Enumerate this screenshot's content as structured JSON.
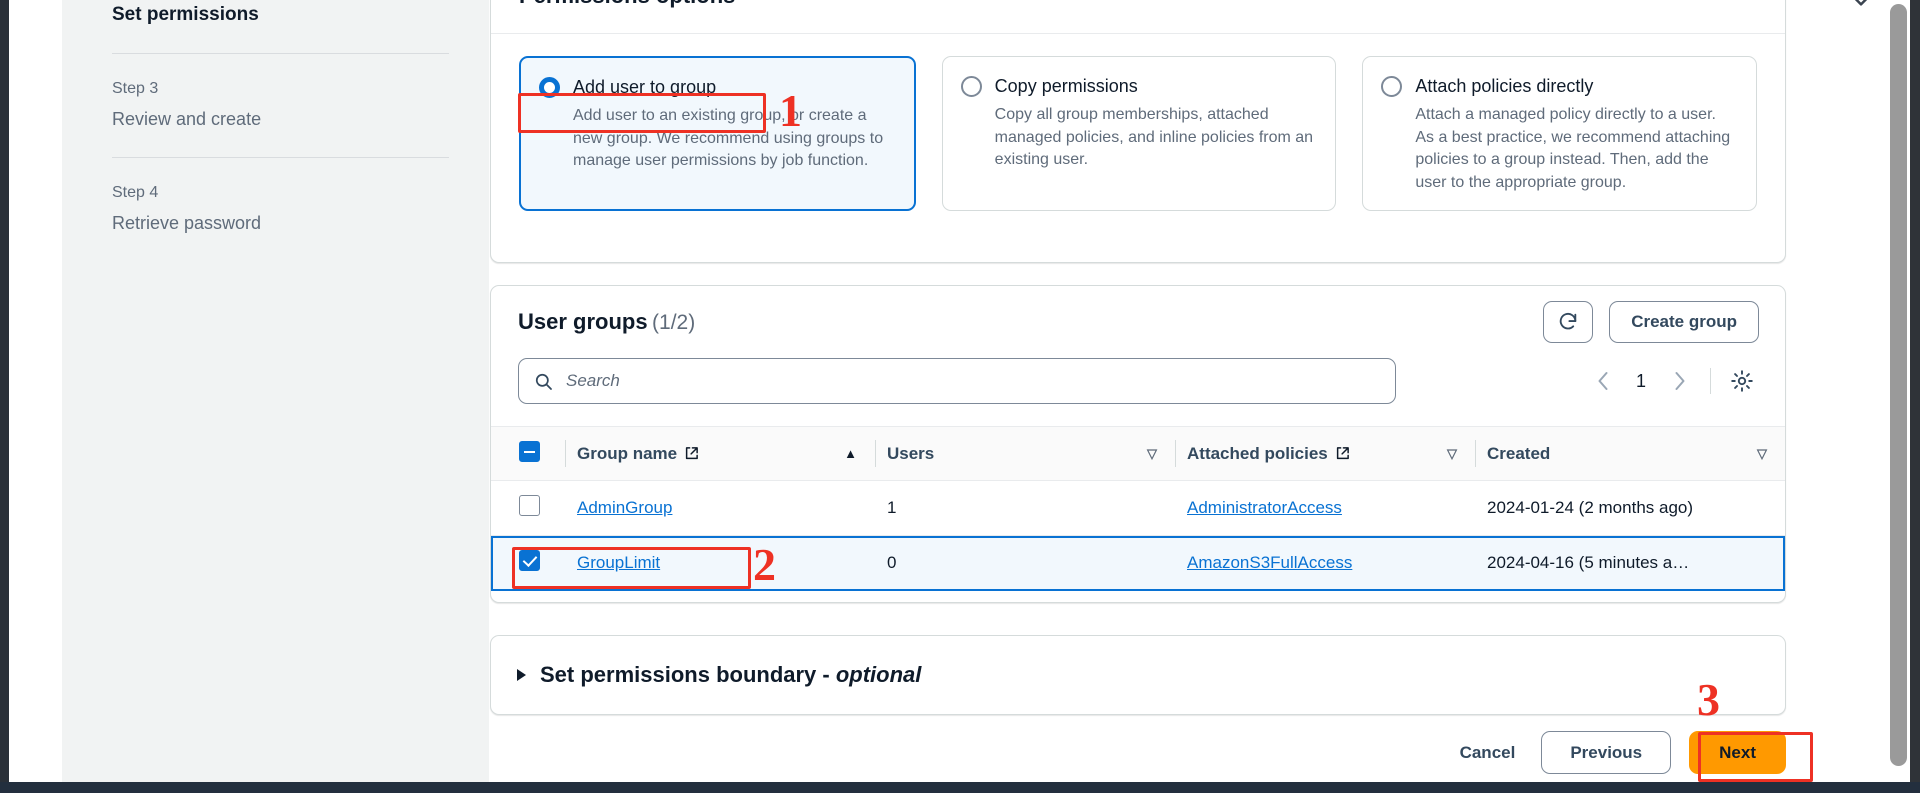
{
  "sidebar": {
    "current_step_title": "Set permissions",
    "steps": [
      {
        "num": "Step 3",
        "label": "Review and create"
      },
      {
        "num": "Step 4",
        "label": "Retrieve password"
      }
    ]
  },
  "permissions_options": {
    "heading": "Permissions options",
    "cards": [
      {
        "title": "Add user to group",
        "description": "Add user to an existing group, or create a new group. We recommend using groups to manage user permissions by job function.",
        "selected": true
      },
      {
        "title": "Copy permissions",
        "description": "Copy all group memberships, attached managed policies, and inline policies from an existing user.",
        "selected": false
      },
      {
        "title": "Attach policies directly",
        "description": "Attach a managed policy directly to a user. As a best practice, we recommend attaching policies to a group instead. Then, add the user to the appropriate group.",
        "selected": false
      }
    ]
  },
  "user_groups": {
    "title": "User groups",
    "count": "(1/2)",
    "refresh_icon": "refresh-icon",
    "create_group_label": "Create group",
    "search": {
      "placeholder": "Search",
      "value": "",
      "icon": "search-icon"
    },
    "pagination": {
      "prev_icon": "chevron-left-icon",
      "page": "1",
      "next_icon": "chevron-right-icon",
      "settings_icon": "gear-icon"
    },
    "columns": [
      {
        "label": "Group name",
        "external_link": true,
        "sort": "asc"
      },
      {
        "label": "Users",
        "external_link": false,
        "sort": "none"
      },
      {
        "label": "Attached policies",
        "external_link": true,
        "sort": "none"
      },
      {
        "label": "Created",
        "external_link": false,
        "sort": "none"
      }
    ],
    "rows": [
      {
        "selected": false,
        "group_name": "AdminGroup",
        "users": "1",
        "attached_policies": "AdministratorAccess",
        "created": "2024-01-24 (2 months ago)"
      },
      {
        "selected": true,
        "group_name": "GroupLimit",
        "users": "0",
        "attached_policies": "AmazonS3FullAccess",
        "created": "2024-04-16 (5 minutes a…"
      }
    ]
  },
  "permissions_boundary": {
    "title": "Set permissions boundary - ",
    "optional": "optional"
  },
  "footer": {
    "cancel": "Cancel",
    "previous": "Previous",
    "next": "Next"
  },
  "annotations": [
    {
      "number": "1"
    },
    {
      "number": "2"
    },
    {
      "number": "3"
    }
  ],
  "colors": {
    "accent_blue": "#0972d3",
    "next_orange": "#ff9900",
    "annotation_red": "#ee3124",
    "sidebar_bg": "#f1f3f3"
  }
}
